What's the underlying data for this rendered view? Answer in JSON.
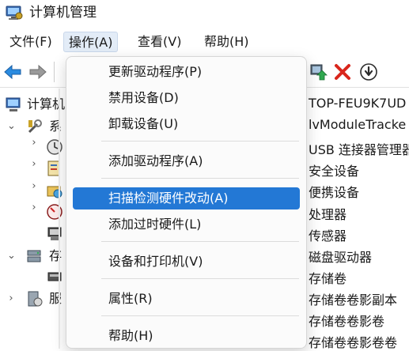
{
  "window": {
    "title": "计算机管理"
  },
  "menubar": {
    "items": [
      "文件(F)",
      "操作(A)",
      "查看(V)",
      "帮助(H)"
    ],
    "active_index": 1
  },
  "context_menu": {
    "items": [
      "更新驱动程序(P)",
      "禁用设备(D)",
      "卸载设备(U)",
      "添加驱动程序(A)",
      "扫描检测硬件改动(A)",
      "添加过时硬件(L)",
      "设备和打印机(V)",
      "属性(R)",
      "帮助(H)"
    ],
    "highlighted_index": 4
  },
  "tree": {
    "root": "计算机",
    "system_tools": "系",
    "storage": "存",
    "services": "服"
  },
  "right_list": [
    "TOP-FEU9K7UD",
    "lvModuleTracke",
    "USB 连接器管理器",
    "安全设备",
    "便携设备",
    "处理器",
    "传感器",
    "磁盘驱动器",
    "存储卷",
    "存储卷卷影副本",
    "存储卷卷影卷",
    "存储卷卷影卷卷"
  ],
  "colors": {
    "highlight": "#2378d5",
    "menu_active_bg": "#e3ecf7",
    "delete_red": "#d9261c",
    "nav_arrow_blue": "#2a8be0"
  },
  "icons": {
    "app": "computer-management-icon",
    "back": "back-arrow-icon",
    "forward": "forward-arrow-icon",
    "scan": "scan-hardware-icon",
    "delete": "delete-icon",
    "download": "download-icon"
  }
}
